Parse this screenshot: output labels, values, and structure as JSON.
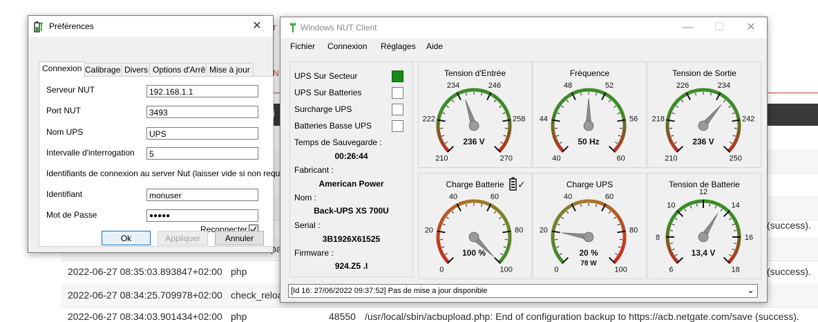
{
  "background": {
    "side_letters": [
      {
        "text": "r"
      },
      {
        "text": "s"
      },
      {
        "text": "N"
      },
      {
        "text": "i"
      },
      {
        "text": "pa"
      }
    ],
    "success_texts": [
      "(success).",
      "(success)."
    ],
    "log_rows": [
      {
        "timestamp": "2022-06-27 08:35:03.893847+02:00",
        "process": "php",
        "pid": "",
        "message": ""
      },
      {
        "timestamp": "2022-06-27 08:34:25.709978+02:00",
        "process": "check_reload_status",
        "pid": "",
        "message": ""
      },
      {
        "timestamp": "2022-06-27 08:34:03.901434+02:00",
        "process": "php",
        "pid": "48550",
        "message": "/usr/local/sbin/acbupload.php: End of configuration backup to https://acb.netgate.com/save (success)."
      }
    ]
  },
  "prefs": {
    "title": "Préférences",
    "close_glyph": "✕",
    "tabs": [
      {
        "label": "Connexion"
      },
      {
        "label": "Calibrage"
      },
      {
        "label": "Divers"
      },
      {
        "label": "Options d'Arrêt"
      },
      {
        "label": "Mise à jour"
      }
    ],
    "fields": {
      "server_label": "Serveur NUT",
      "server_value": "192.168.1.1",
      "port_label": "Port NUT",
      "port_value": "3493",
      "ups_label": "Nom UPS",
      "ups_value": "UPS",
      "interval_label": "Intervalle d'interrogation",
      "interval_value": "5",
      "credentials_hint": "Identifiants de connexion au server Nut (laisser vide si non requis)",
      "login_label": "Identifiant",
      "login_value": "monuser",
      "password_label": "Mot de Passe",
      "password_value": "●●●●●",
      "reconnect_label": "Reconnecter",
      "reconnect_checked": true
    },
    "buttons": {
      "ok": "Ok",
      "apply": "Appliquer",
      "cancel": "Annuler"
    }
  },
  "nut": {
    "title": "Windows NUT Client",
    "window_buttons": {
      "minimize": "—",
      "maximize": "☐",
      "close": "✕"
    },
    "menu": [
      {
        "label": "Fichier"
      },
      {
        "label": "Connexion"
      },
      {
        "label": "Réglages"
      },
      {
        "label": "Aide"
      }
    ],
    "status_flags": [
      {
        "label": "UPS Sur Secteur",
        "active": true
      },
      {
        "label": "UPS Sur Batteries",
        "active": false
      },
      {
        "label": "Surcharge UPS",
        "active": false
      },
      {
        "label": "Batteries Basse UPS",
        "active": false
      }
    ],
    "indicator_active_color": "#1b8a1b",
    "info": {
      "backup_time_label": "Temps de Sauvegarde :",
      "backup_time": "00:26:44",
      "maker_label": "Fabricant :",
      "maker": "American Power",
      "name_label": "Nom :",
      "name": "Back-UPS XS 700U",
      "serial_label": "Serial :",
      "serial": "3B1926X61525",
      "firmware_label": "Firmware :",
      "firmware": "924.Z5 .I"
    },
    "gauges": [
      {
        "title": "Tension d'Entrée",
        "min": 210,
        "max": 270,
        "ticks": [
          210,
          222,
          234,
          246,
          258,
          270
        ],
        "value": 236,
        "display": "236 V",
        "sub": "",
        "scheme": "redgreenred"
      },
      {
        "title": "Fréquence",
        "min": 40,
        "max": 60,
        "ticks": [
          40,
          44,
          48,
          52,
          56,
          60
        ],
        "value": 50,
        "display": "50 Hz",
        "sub": "",
        "scheme": "redgreenred"
      },
      {
        "title": "Tension de Sortie",
        "min": 210,
        "max": 250,
        "ticks": [
          210,
          218,
          226,
          234,
          242,
          250
        ],
        "value": 236,
        "display": "236 V",
        "sub": "",
        "scheme": "redgreenred"
      },
      {
        "title": "Charge Batterie",
        "min": 0,
        "max": 100,
        "ticks": [
          0,
          20,
          40,
          60,
          80,
          100
        ],
        "value": 100,
        "display": "100 %",
        "sub": "",
        "scheme": "redgreen"
      },
      {
        "title": "Charge UPS",
        "min": 0,
        "max": 100,
        "ticks": [
          0,
          20,
          40,
          60,
          80,
          100
        ],
        "value": 20,
        "display": "20 %",
        "sub": "78 W",
        "scheme": "greenred"
      },
      {
        "title": "Tension de Batterie",
        "min": 6,
        "max": 18,
        "ticks": [
          6,
          8,
          10,
          12,
          14,
          16,
          18
        ],
        "value": 13.4,
        "display": "13,4 V",
        "sub": "",
        "scheme": "redgreenred"
      }
    ],
    "battery_icon_glyph": "✓",
    "status_bar": "[Id 16: 27/06/2022 09:37:52] Pas de mise a jour disponible",
    "status_bar_arrow": "⌄"
  }
}
